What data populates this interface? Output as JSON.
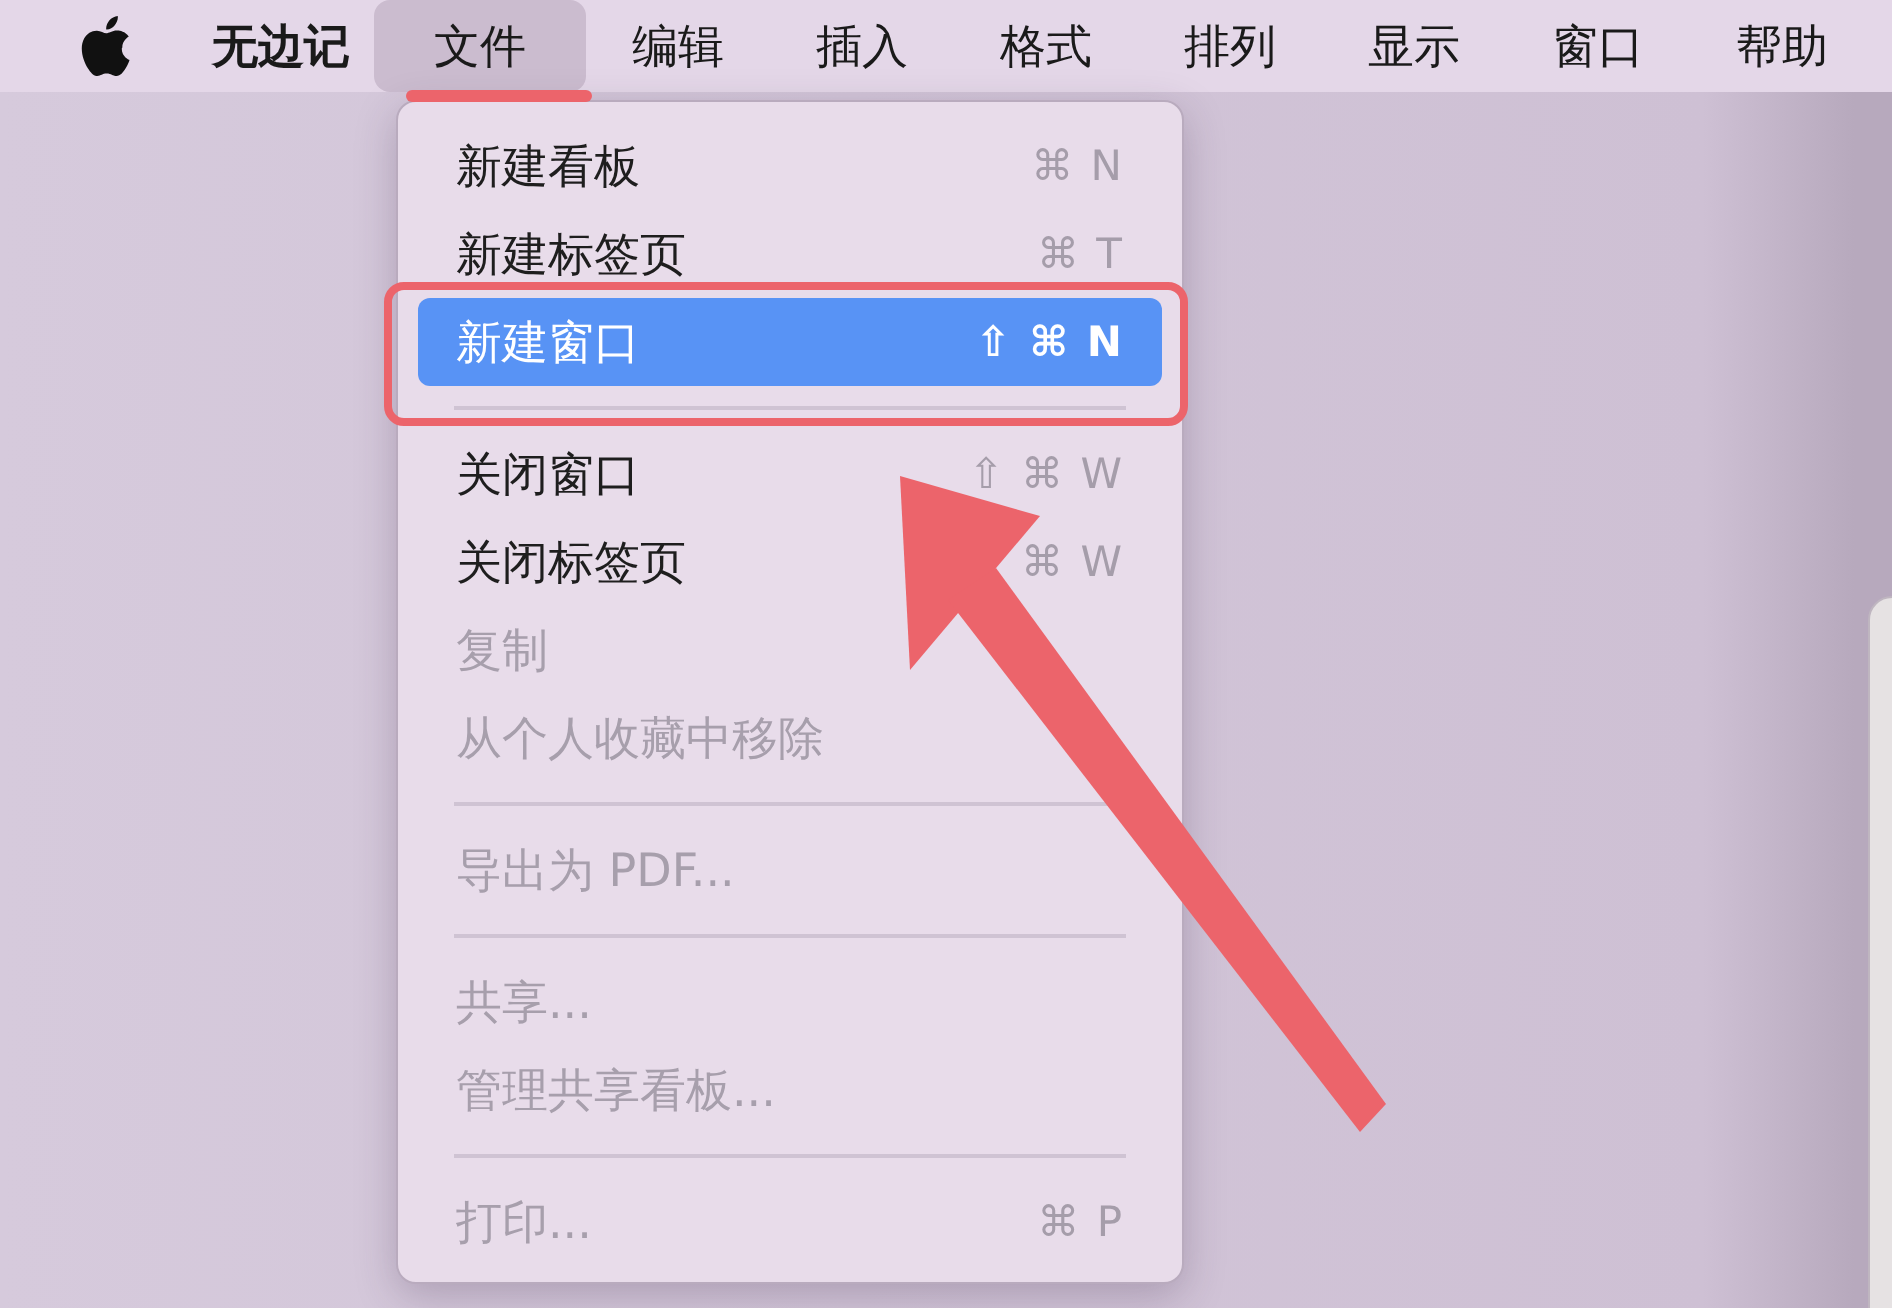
{
  "menu_bar": {
    "app_name": "无边记",
    "items": [
      {
        "label": "文件",
        "selected": true
      },
      {
        "label": "编辑",
        "selected": false
      },
      {
        "label": "插入",
        "selected": false
      },
      {
        "label": "格式",
        "selected": false
      },
      {
        "label": "排列",
        "selected": false
      },
      {
        "label": "显示",
        "selected": false
      },
      {
        "label": "窗口",
        "selected": false
      },
      {
        "label": "帮助",
        "selected": false
      }
    ]
  },
  "file_menu": {
    "items": [
      {
        "kind": "item",
        "label": "新建看板",
        "shortcut": "⌘ N",
        "disabled": false,
        "selected": false
      },
      {
        "kind": "item",
        "label": "新建标签页",
        "shortcut": "⌘ T",
        "disabled": false,
        "selected": false
      },
      {
        "kind": "item",
        "label": "新建窗口",
        "shortcut": "⇧ ⌘ N",
        "disabled": false,
        "selected": true
      },
      {
        "kind": "separator"
      },
      {
        "kind": "item",
        "label": "关闭窗口",
        "shortcut": "⇧ ⌘ W",
        "disabled": false,
        "selected": false
      },
      {
        "kind": "item",
        "label": "关闭标签页",
        "shortcut": "⌘ W",
        "disabled": false,
        "selected": false
      },
      {
        "kind": "item",
        "label": "复制",
        "disabled": true,
        "selected": false
      },
      {
        "kind": "item",
        "label": "从个人收藏中移除",
        "disabled": true,
        "selected": false
      },
      {
        "kind": "separator"
      },
      {
        "kind": "item",
        "label": "导出为 PDF...",
        "disabled": true,
        "selected": false
      },
      {
        "kind": "separator"
      },
      {
        "kind": "item",
        "label": "共享...",
        "disabled": true,
        "selected": false
      },
      {
        "kind": "item",
        "label": "管理共享看板...",
        "disabled": true,
        "selected": false
      },
      {
        "kind": "separator"
      },
      {
        "kind": "item",
        "label": "打印...",
        "shortcut": "⌘ P",
        "disabled": true,
        "selected": false
      }
    ]
  }
}
